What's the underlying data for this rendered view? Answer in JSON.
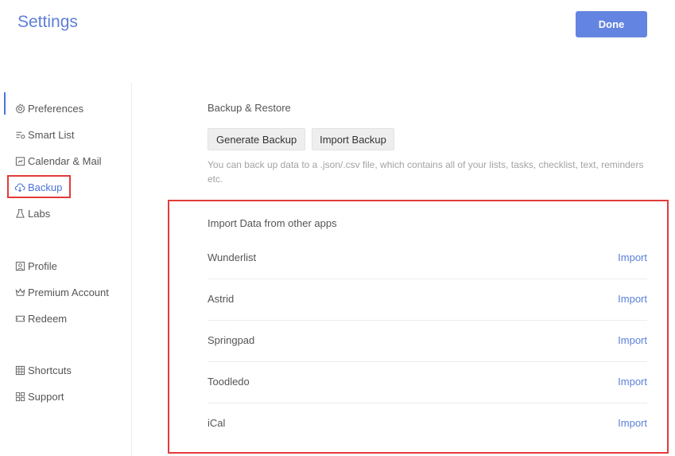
{
  "header": {
    "title": "Settings",
    "done_label": "Done"
  },
  "sidebar": {
    "items": [
      {
        "label": "Preferences",
        "icon": "gear-icon"
      },
      {
        "label": "Smart List",
        "icon": "smart-list-icon"
      },
      {
        "label": "Calendar & Mail",
        "icon": "calendar-icon"
      },
      {
        "label": "Backup",
        "icon": "cloud-icon",
        "active": true
      },
      {
        "label": "Labs",
        "icon": "flask-icon"
      },
      {
        "label": "Profile",
        "icon": "profile-icon"
      },
      {
        "label": "Premium Account",
        "icon": "crown-icon"
      },
      {
        "label": "Redeem",
        "icon": "ticket-icon"
      },
      {
        "label": "Shortcuts",
        "icon": "keyboard-icon"
      },
      {
        "label": "Support",
        "icon": "grid-icon"
      }
    ]
  },
  "backup": {
    "title": "Backup & Restore",
    "generate_label": "Generate Backup",
    "import_label": "Import Backup",
    "hint": "You can back up data to a .json/.csv file, which contains all of your lists, tasks, checklist, text, reminders etc."
  },
  "import_section": {
    "title": "Import Data from other apps",
    "apps": [
      {
        "name": "Wunderlist",
        "action": "Import"
      },
      {
        "name": "Astrid",
        "action": "Import"
      },
      {
        "name": "Springpad",
        "action": "Import"
      },
      {
        "name": "Toodledo",
        "action": "Import"
      },
      {
        "name": "iCal",
        "action": "Import"
      }
    ]
  },
  "colors": {
    "accent": "#5e7ed8",
    "highlight": "#e23b3b"
  }
}
